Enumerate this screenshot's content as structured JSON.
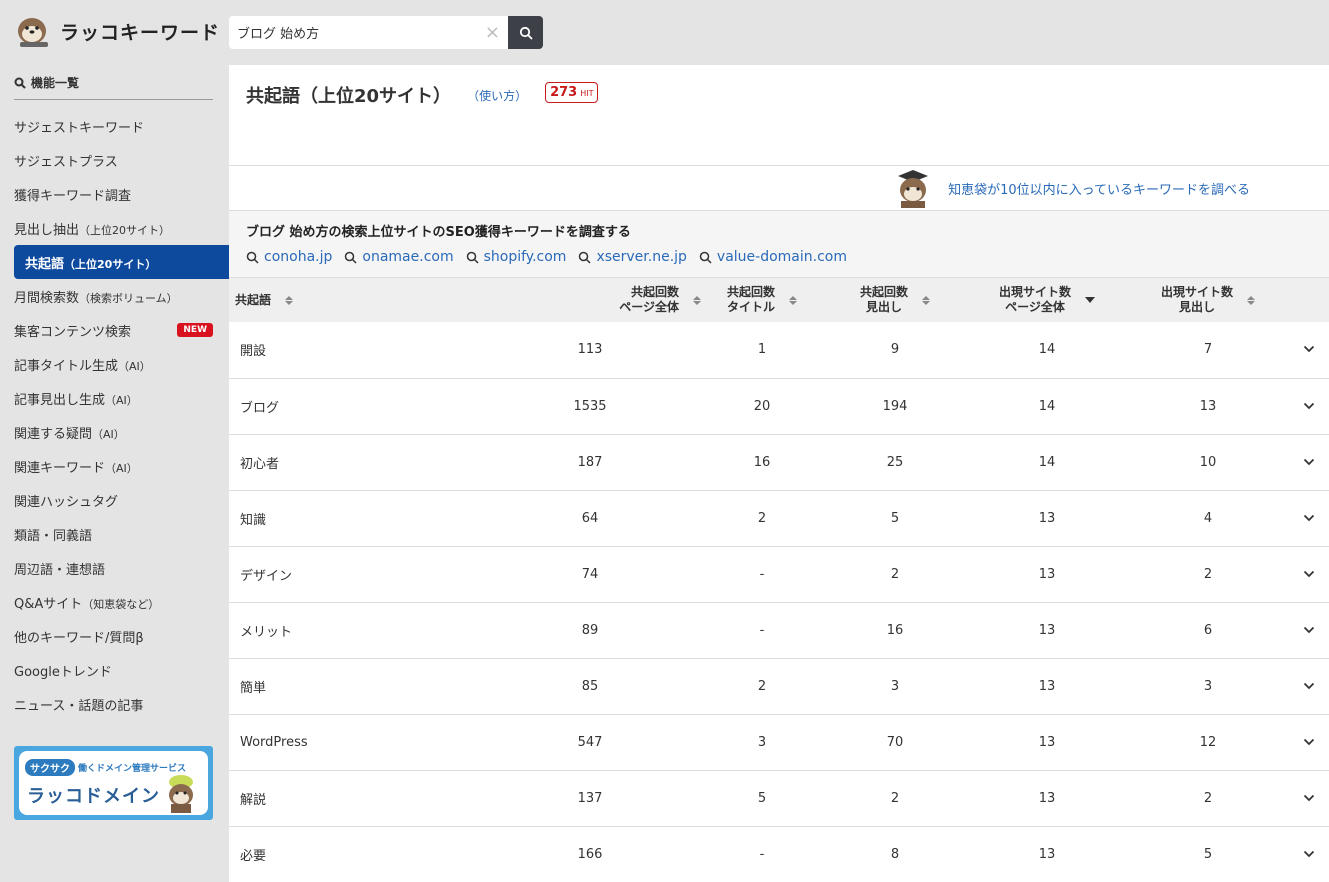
{
  "header": {
    "logo_text": "ラッコキーワード",
    "search_value": "ブログ 始め方",
    "clear_label": "×"
  },
  "sidebar": {
    "heading": "機能一覧",
    "items": [
      {
        "label": "サジェストキーワード",
        "sub": ""
      },
      {
        "label": "サジェストプラス",
        "sub": ""
      },
      {
        "label": "獲得キーワード調査",
        "sub": ""
      },
      {
        "label": "見出し抽出",
        "sub": "（上位20サイト）"
      },
      {
        "label": "共起語",
        "sub": "（上位20サイト）"
      },
      {
        "label": "月間検索数",
        "sub": "（検索ボリューム）"
      },
      {
        "label": "集客コンテンツ検索",
        "sub": "",
        "badge": "NEW"
      },
      {
        "label": "記事タイトル生成",
        "sub": "（AI）"
      },
      {
        "label": "記事見出し生成",
        "sub": "（AI）"
      },
      {
        "label": "関連する疑問",
        "sub": "（AI）"
      },
      {
        "label": "関連キーワード",
        "sub": "（AI）"
      },
      {
        "label": "関連ハッシュタグ",
        "sub": ""
      },
      {
        "label": "類語・同義語",
        "sub": ""
      },
      {
        "label": "周辺語・連想語",
        "sub": ""
      },
      {
        "label": "Q&Aサイト",
        "sub": "（知恵袋など）"
      },
      {
        "label": "他のキーワード/質問β",
        "sub": ""
      },
      {
        "label": "Googleトレンド",
        "sub": ""
      },
      {
        "label": "ニュース・話題の記事",
        "sub": ""
      }
    ],
    "banner_pill": "サクサク",
    "banner_tagline": "働くドメイン管理サービス",
    "banner_title": "ラッコドメイン"
  },
  "main": {
    "title": "共起語（上位20サイト）",
    "howto": "（使い方）",
    "hit_count": "273",
    "hit_label": "HIT",
    "chie_link": "知恵袋が10位以内に入っているキーワードを調べる",
    "seo_title": "ブログ 始め方の検索上位サイトのSEO獲得キーワードを調査する",
    "seo_links": [
      "conoha.jp",
      "onamae.com",
      "shopify.com",
      "xserver.ne.jp",
      "value-domain.com"
    ]
  },
  "table": {
    "columns": [
      {
        "line1": "共起語",
        "line2": ""
      },
      {
        "line1": "共起回数",
        "line2": "ページ全体"
      },
      {
        "line1": "共起回数",
        "line2": "タイトル"
      },
      {
        "line1": "共起回数",
        "line2": "見出し"
      },
      {
        "line1": "出現サイト数",
        "line2": "ページ全体"
      },
      {
        "line1": "出現サイト数",
        "line2": "見出し"
      }
    ],
    "rows": [
      [
        "開設",
        "113",
        "1",
        "9",
        "14",
        "7"
      ],
      [
        "ブログ",
        "1535",
        "20",
        "194",
        "14",
        "13"
      ],
      [
        "初心者",
        "187",
        "16",
        "25",
        "14",
        "10"
      ],
      [
        "知識",
        "64",
        "2",
        "5",
        "13",
        "4"
      ],
      [
        "デザイン",
        "74",
        "-",
        "2",
        "13",
        "2"
      ],
      [
        "メリット",
        "89",
        "-",
        "16",
        "13",
        "6"
      ],
      [
        "簡単",
        "85",
        "2",
        "3",
        "13",
        "3"
      ],
      [
        "WordPress",
        "547",
        "3",
        "70",
        "13",
        "12"
      ],
      [
        "解説",
        "137",
        "5",
        "2",
        "13",
        "2"
      ],
      [
        "必要",
        "166",
        "-",
        "8",
        "13",
        "5"
      ]
    ]
  },
  "colors": {
    "accent_blue": "#0d4a9e",
    "link_blue": "#2a6ab8",
    "hit_red": "#c81a1a"
  }
}
